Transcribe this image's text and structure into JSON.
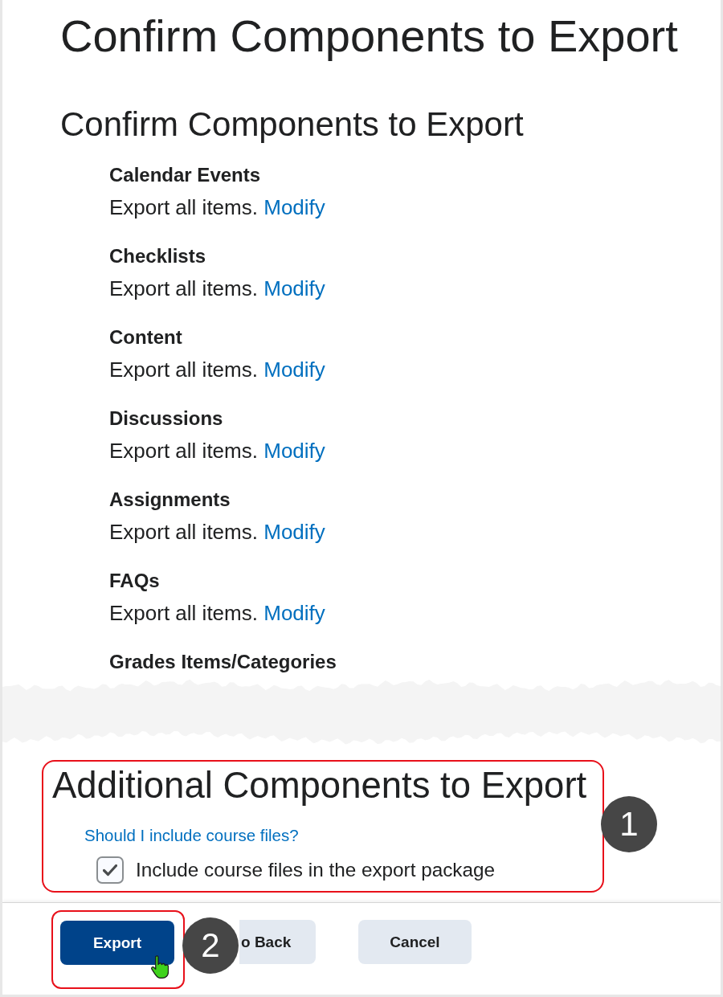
{
  "page_title": "Confirm Components to Export",
  "section_title": "Confirm Components to Export",
  "components": [
    {
      "name": "Calendar Events",
      "status": "Export all items.",
      "action": "Modify"
    },
    {
      "name": "Checklists",
      "status": "Export all items.",
      "action": "Modify"
    },
    {
      "name": "Content",
      "status": "Export all items.",
      "action": "Modify"
    },
    {
      "name": "Discussions",
      "status": "Export all items.",
      "action": "Modify"
    },
    {
      "name": "Assignments",
      "status": "Export all items.",
      "action": "Modify"
    },
    {
      "name": "FAQs",
      "status": "Export all items.",
      "action": "Modify"
    },
    {
      "name": "Grades Items/Categories"
    }
  ],
  "additional": {
    "title": "Additional Components to Export",
    "help_link": "Should I include course files?",
    "option": {
      "label": "Include course files in the export package",
      "checked": true
    },
    "callout": "1"
  },
  "footer": {
    "buttons": [
      {
        "label": "Export",
        "kind": "primary",
        "highlighted": true
      },
      {
        "label": "o Back",
        "kind": "secondary",
        "highlighted": false
      },
      {
        "label": "Cancel",
        "kind": "secondary",
        "highlighted": false
      }
    ],
    "callout": "2"
  }
}
